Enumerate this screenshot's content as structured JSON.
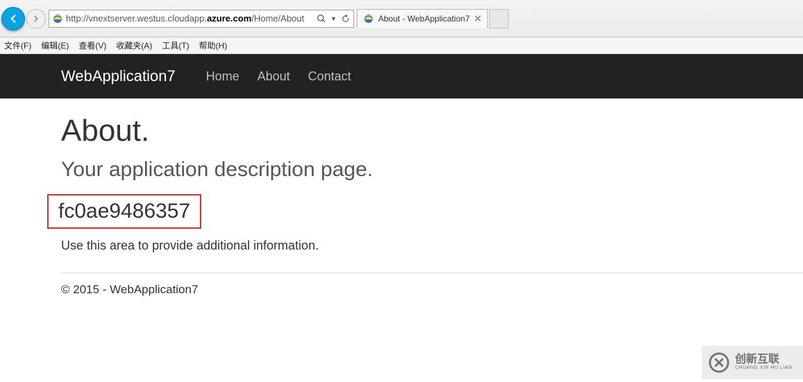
{
  "browser": {
    "url_pre": "http://vnextserver.westus.cloudapp.",
    "url_bold": "azure.com",
    "url_post": "/Home/About",
    "tab_title": "About - WebApplication7"
  },
  "menu": {
    "file": "文件(F)",
    "edit": "编辑(E)",
    "view": "查看(V)",
    "favorites": "收藏夹(A)",
    "tools": "工具(T)",
    "help": "帮助(H)"
  },
  "nav": {
    "brand": "WebApplication7",
    "home": "Home",
    "about": "About",
    "contact": "Contact"
  },
  "page": {
    "title": "About.",
    "subtitle": "Your application description page.",
    "hash": "fc0ae9486357",
    "body": "Use this area to provide additional information.",
    "footer": "© 2015 - WebApplication7"
  },
  "watermark": {
    "cn": "创新互联",
    "en": "CHUANG XIN HU LIAN"
  }
}
